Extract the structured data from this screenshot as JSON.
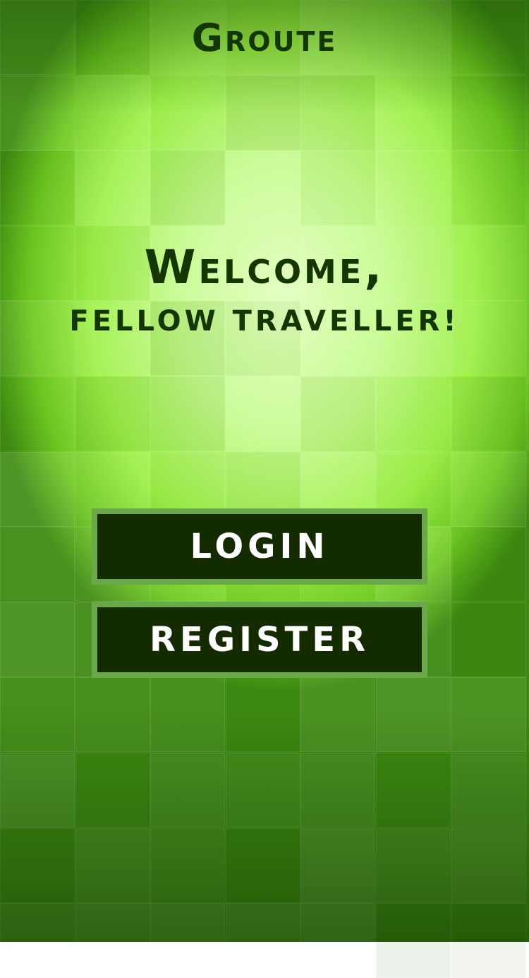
{
  "app": {
    "title": "Groute"
  },
  "welcome": {
    "heading": "Welcome,",
    "subheading": "fellow traveller!"
  },
  "actions": {
    "login_label": "LOGIN",
    "register_label": "REGISTER"
  },
  "colors": {
    "text_dark": "#143600",
    "button_fill": "#142b00",
    "button_border": "#6aa84a",
    "button_text": "#ffffff",
    "background_light": "#e2ffc0",
    "background_mid": "#9ef048",
    "background_dark": "#3e8a12"
  }
}
